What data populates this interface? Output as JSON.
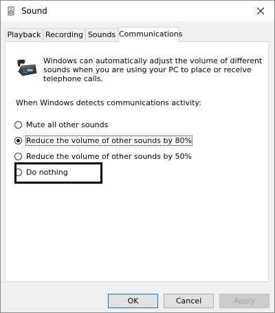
{
  "window": {
    "title": "Sound",
    "icon": "speaker-icon"
  },
  "tabs": [
    {
      "label": "Playback",
      "active": false
    },
    {
      "label": "Recording",
      "active": false
    },
    {
      "label": "Sounds",
      "active": false
    },
    {
      "label": "Communications",
      "active": true
    }
  ],
  "communications": {
    "intro_lines": [
      "Windows can automatically adjust the volume of different",
      "sounds when you are using your PC to place or receive",
      "telephone calls."
    ],
    "section_label": "When Windows detects communications activity:",
    "options": [
      {
        "label": "Mute all other sounds",
        "checked": false
      },
      {
        "label": "Reduce the volume of other sounds by 80%",
        "checked": true
      },
      {
        "label": "Reduce the volume of other sounds by 50%",
        "checked": false
      },
      {
        "label": "Do nothing",
        "checked": false
      }
    ]
  },
  "buttons": {
    "ok": "OK",
    "cancel": "Cancel",
    "apply": "Apply"
  }
}
